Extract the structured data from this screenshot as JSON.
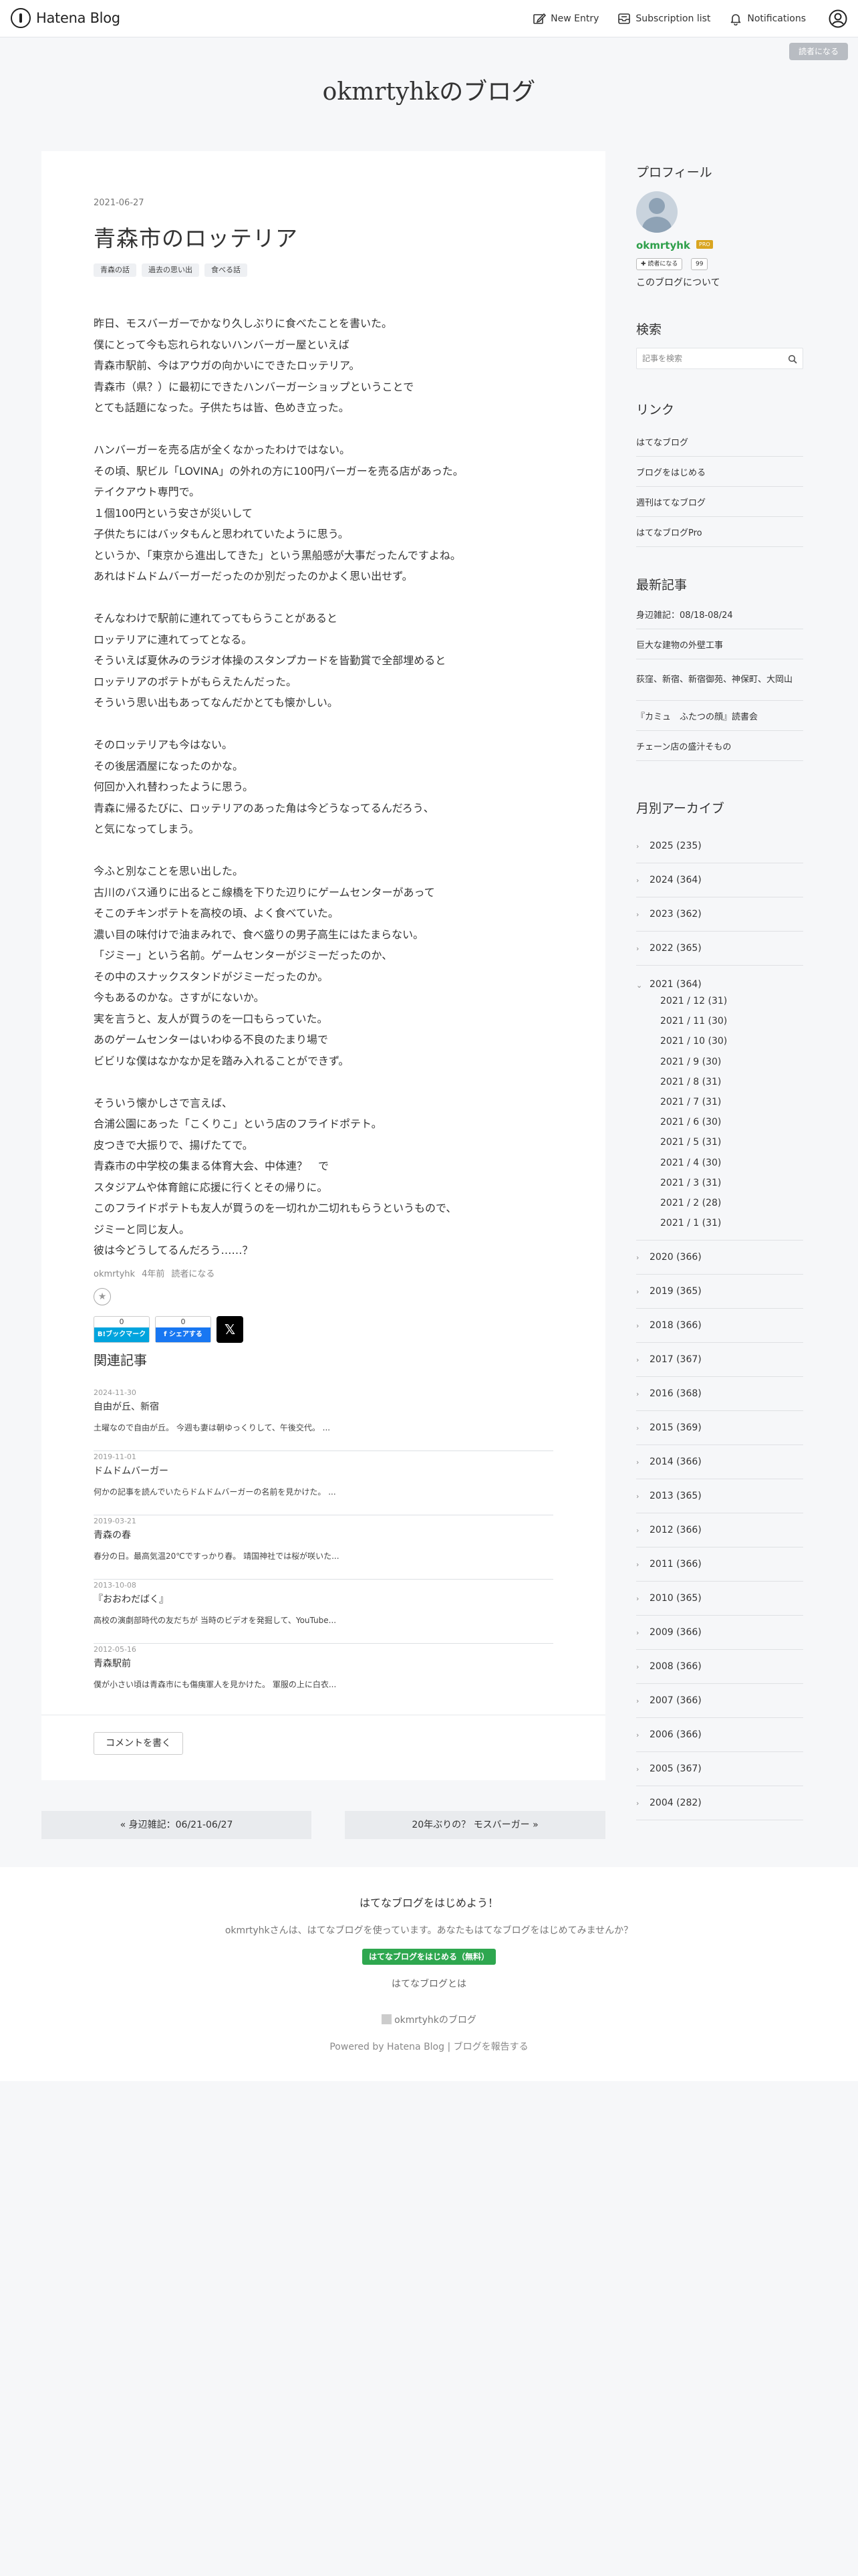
{
  "topbar": {
    "logo_text": "Hatena Blog",
    "new_entry": "New Entry",
    "subscription_list": "Subscription list",
    "notifications": "Notifications"
  },
  "reader_badge": "読者になる",
  "blog_title": "okmrtyhkのブログ",
  "article": {
    "date": "2021-06-27",
    "title": "青森市のロッテリア",
    "categories": [
      "青森の話",
      "過去の思い出",
      "食べる話"
    ],
    "paragraphs": [
      [
        "昨日、モスバーガーでかなり久しぶりに食べたことを書いた。",
        "僕にとって今も忘れられないハンバーガー屋といえば",
        "青森市駅前、今はアウガの向かいにできたロッテリア。",
        "青森市（県？）に最初にできたハンバーガーショップということで",
        "とても話題になった。子供たちは皆、色めき立った。"
      ],
      [
        "ハンバーガーを売る店が全くなかったわけではない。",
        "その頃、駅ビル「LOVINA」の外れの方に100円バーガーを売る店があった。",
        "テイクアウト専門で。",
        "１個100円という安さが災いして",
        "子供たちにはバッタもんと思われていたように思う。",
        "というか、「東京から進出してきた」という黒船感が大事だったんですよね。",
        "あれはドムドムバーガーだったのか別だったのかよく思い出せず。"
      ],
      [
        "そんなわけで駅前に連れてってもらうことがあると",
        "ロッテリアに連れてってとなる。",
        "そういえば夏休みのラジオ体操のスタンプカードを皆勤賞で全部埋めると",
        "ロッテリアのポテトがもらえたんだった。",
        "そういう思い出もあってなんだかとても懐かしい。"
      ],
      [
        "そのロッテリアも今はない。",
        "その後居酒屋になったのかな。",
        "何回か入れ替わったように思う。",
        "青森に帰るたびに、ロッテリアのあった角は今どうなってるんだろう、",
        "と気になってしまう。"
      ],
      [
        "今ふと別なことを思い出した。",
        "古川のバス通りに出るとこ線橋を下りた辺りにゲームセンターがあって",
        "そこのチキンポテトを高校の頃、よく食べていた。",
        "濃い目の味付けで油まみれで、食べ盛りの男子高生にはたまらない。",
        "「ジミー」という名前。ゲームセンターがジミーだったのか、",
        "その中のスナックスタンドがジミーだったのか。",
        "今もあるのかな。さすがにないか。",
        "実を言うと、友人が買うのを一口もらっていた。",
        "あのゲームセンターはいわゆる不良のたまり場で",
        "ビビリな僕はなかなか足を踏み入れることができず。"
      ],
      [
        "そういう懐かしさで言えば、",
        "合浦公園にあった「こくりこ」という店のフライドポテト。",
        "皮つきで大振りで、揚げたてで。",
        "青森市の中学校の集まる体育大会、中体連？　で",
        "スタジアムや体育館に応援に行くとその帰りに。",
        "このフライドポテトも友人が買うのを一切れか二切れもらうというもので、",
        "ジミーと同じ友人。",
        "彼は今どうしてるんだろう……？"
      ]
    ],
    "author": "okmrtyhk",
    "posted_ago": "4年前",
    "subscribe_link": "読者になる",
    "hatebu_count": "0",
    "hatebu_label": "B!ブックマーク",
    "fb_count": "0",
    "fb_label": "f シェアする",
    "x_label": "𝕏",
    "related_heading": "関連記事",
    "related": [
      {
        "date": "2024-11-30",
        "title": "自由が丘、新宿",
        "snippet": "土曜なので自由が丘。 今週も妻は朝ゆっくりして、午後交代。 ..."
      },
      {
        "date": "2019-11-01",
        "title": "ドムドムバーガー",
        "snippet": "何かの記事を読んでいたらドムドムバーガーの名前を見かけた。 ..."
      },
      {
        "date": "2019-03-21",
        "title": "青森の春",
        "snippet": "春分の日。最高気温20℃ですっかり春。 靖国神社では桜が咲いた..."
      },
      {
        "date": "2013-10-08",
        "title": "『おおわだばく』",
        "snippet": "高校の演劇部時代の友だちが 当時のビデオを発掘して、YouTube..."
      },
      {
        "date": "2012-05-16",
        "title": "青森駅前",
        "snippet": "僕が小さい頃は青森市にも傷痍軍人を見かけた。 軍服の上に白衣..."
      }
    ],
    "comment_button": "コメントを書く"
  },
  "pager": {
    "prev": "« 身辺雑記：06/21-06/27",
    "next": "20年ぶりの？ モスバーガー »"
  },
  "sidebar": {
    "profile_heading": "プロフィール",
    "profile_name": "okmrtyhk",
    "pro_badge": "PRO",
    "follow_label": "読者になる",
    "follow_count": "99",
    "about_link": "このブログについて",
    "search_heading": "検索",
    "search_placeholder": "記事を検索",
    "links_heading": "リンク",
    "links": [
      "はてなブログ",
      "ブログをはじめる",
      "週刊はてなブログ",
      "はてなブログPro"
    ],
    "recent_heading": "最新記事",
    "recent": [
      "身辺雑記：08/18-08/24",
      "巨大な建物の外壁工事",
      "荻窪、新宿、新宿御苑、神保町、大岡山",
      "『カミュ　ふたつの顔』読書会",
      "チェーン店の盛汁そもの"
    ],
    "archive_heading": "月別アーカイブ",
    "archive_before": [
      "2025 (235)",
      "2024 (364)",
      "2023 (362)",
      "2022 (365)"
    ],
    "archive_open": "2021 (364)",
    "archive_months": [
      "2021 / 12 (31)",
      "2021 / 11 (30)",
      "2021 / 10 (30)",
      "2021 / 9 (30)",
      "2021 / 8 (31)",
      "2021 / 7 (31)",
      "2021 / 6 (30)",
      "2021 / 5 (31)",
      "2021 / 4 (30)",
      "2021 / 3 (31)",
      "2021 / 2 (28)",
      "2021 / 1 (31)"
    ],
    "archive_after": [
      "2020 (366)",
      "2019 (365)",
      "2018 (366)",
      "2017 (367)",
      "2016 (368)",
      "2015 (369)",
      "2014 (366)",
      "2013 (365)",
      "2012 (366)",
      "2011 (366)",
      "2010 (365)",
      "2009 (366)",
      "2008 (366)",
      "2007 (366)",
      "2006 (366)",
      "2005 (367)",
      "2004 (282)"
    ]
  },
  "footer": {
    "heading": "はてなブログをはじめよう！",
    "description": "okmrtyhkさんは、はてなブログを使っています。あなたもはてなブログをはじめてみませんか？",
    "start_button": "はてなブログをはじめる（無料）",
    "about_link": "はてなブログとは",
    "blog_link": "okmrtyhkのブログ",
    "powered": "Powered by Hatena Blog | ブログを報告する"
  }
}
